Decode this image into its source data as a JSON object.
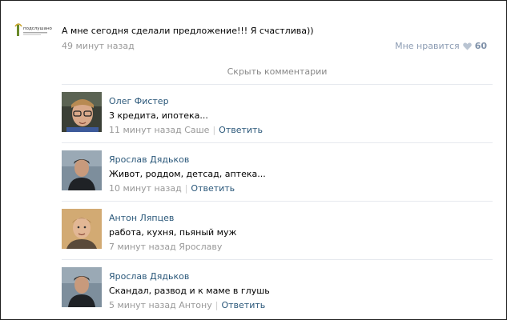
{
  "post": {
    "avatar_text": "подслушано",
    "text": "А мне сегодня сделали предложение!!! Я счастлива))",
    "time": "49 минут назад",
    "like_label": "Мне нравится",
    "like_count": "60",
    "hide_comments": "Скрыть комментарии"
  },
  "comments": [
    {
      "author": "Олег Фистер",
      "text": "3 кредита, ипотека...",
      "time": "11 минут назад",
      "reply_to": "Саше",
      "reply_label": "Ответить"
    },
    {
      "author": "Ярослав Дядьков",
      "text": "Живот, роддом, детсад, аптека...",
      "time": "10 минут назад",
      "reply_to": "",
      "reply_label": "Ответить"
    },
    {
      "author": "Антон Ляпцев",
      "text": "работа, кухня, пьяный муж",
      "time": "7 минут назад",
      "reply_to": "Ярославу",
      "reply_label": ""
    },
    {
      "author": "Ярослав Дядьков",
      "text": "Скандал, развод и к маме в глушь",
      "time": "5 минут назад",
      "reply_to": "Антону",
      "reply_label": "Ответить"
    }
  ],
  "colors": {
    "link": "#2b587a",
    "muted": "#999999",
    "like": "#8c9cb3"
  },
  "icons": {
    "like": "heart-icon"
  }
}
